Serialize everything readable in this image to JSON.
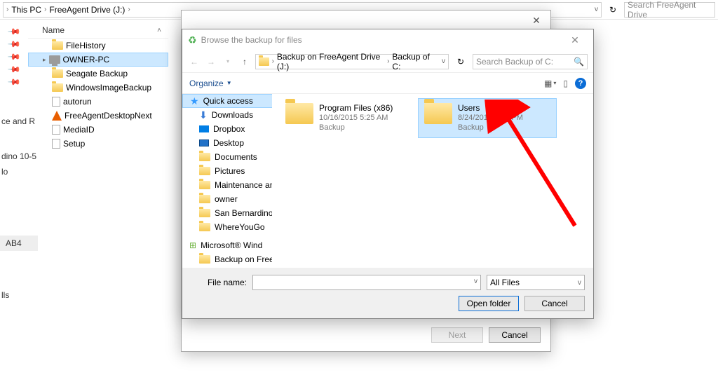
{
  "bg": {
    "breadcrumbs": [
      "This PC",
      "FreeAgent Drive (J:)"
    ],
    "search_placeholder": "Search FreeAgent Drive",
    "name_col": "Name",
    "tree": {
      "items": [
        {
          "label": "FileHistory",
          "type": "folder"
        },
        {
          "label": "OWNER-PC",
          "type": "computer",
          "selected": true
        },
        {
          "label": "Seagate Backup",
          "type": "folder"
        },
        {
          "label": "WindowsImageBackup",
          "type": "folder"
        },
        {
          "label": "autorun",
          "type": "file"
        },
        {
          "label": "FreeAgentDesktopNext",
          "type": "vlc"
        },
        {
          "label": "MediaID",
          "type": "file"
        },
        {
          "label": "Setup",
          "type": "file"
        }
      ]
    },
    "leftcut": [
      "ce and R",
      "dino 10-5",
      "lo",
      "AB4",
      "lls"
    ]
  },
  "wizard": {
    "next": "Next",
    "cancel": "Cancel"
  },
  "dialog": {
    "title": "Browse the backup for files",
    "breadcrumbs": [
      "Backup on FreeAgent Drive (J:)",
      "Backup of C:"
    ],
    "search_placeholder": "Search Backup of C:",
    "organize": "Organize",
    "sidebar": {
      "quick_access": "Quick access",
      "items": [
        {
          "label": "Downloads",
          "icon": "down",
          "pinned": true
        },
        {
          "label": "Dropbox",
          "icon": "dropbox",
          "pinned": true
        },
        {
          "label": "Desktop",
          "icon": "desktop",
          "pinned": true
        },
        {
          "label": "Documents",
          "icon": "folder",
          "pinned": true
        },
        {
          "label": "Pictures",
          "icon": "folder",
          "pinned": true
        },
        {
          "label": "Maintenance an",
          "icon": "folder"
        },
        {
          "label": "owner",
          "icon": "folder"
        },
        {
          "label": "San Bernardino",
          "icon": "folder"
        },
        {
          "label": "WhereYouGo",
          "icon": "folder"
        }
      ],
      "section2": "Microsoft® Wind",
      "section2_child": "Backup on FreeA"
    },
    "content": [
      {
        "title": "Program Files (x86)",
        "date": "10/16/2015 5:25 AM",
        "type": "Backup"
      },
      {
        "title": "Users",
        "date": "8/24/2015 1:44 PM",
        "type": "Backup",
        "selected": true
      }
    ],
    "filename_label": "File name:",
    "filter": "All Files",
    "open": "Open folder",
    "cancel": "Cancel"
  }
}
